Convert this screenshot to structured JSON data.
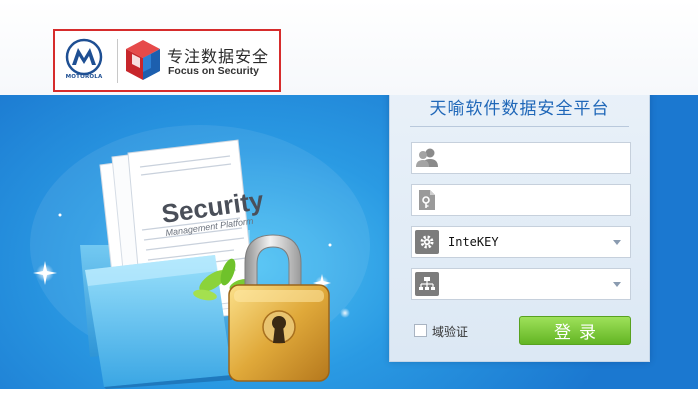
{
  "header": {
    "motorola_wordmark": "MOTOROLA",
    "slogan_cn": "专注数据安全",
    "slogan_en": "Focus on Security"
  },
  "hero": {
    "doc_title": "Security",
    "doc_subtitle": "Management Platform"
  },
  "login": {
    "title": "天喻软件数据安全平台",
    "username": {
      "value": "",
      "placeholder": ""
    },
    "key_file": {
      "value": "",
      "placeholder": ""
    },
    "device_select": {
      "value": "InteKEY"
    },
    "server_select": {
      "value": ""
    },
    "domain_checkbox_label": "域验证",
    "domain_checked": false,
    "submit_label": "登录"
  },
  "colors": {
    "brand_red": "#d62c2c",
    "band_blue": "#2a9ae3",
    "title_blue": "#1f67b8",
    "button_green": "#63b524"
  },
  "icons": [
    "users-icon",
    "key-file-icon",
    "gear-icon",
    "network-icon",
    "padlock-icon",
    "folder-icon"
  ]
}
